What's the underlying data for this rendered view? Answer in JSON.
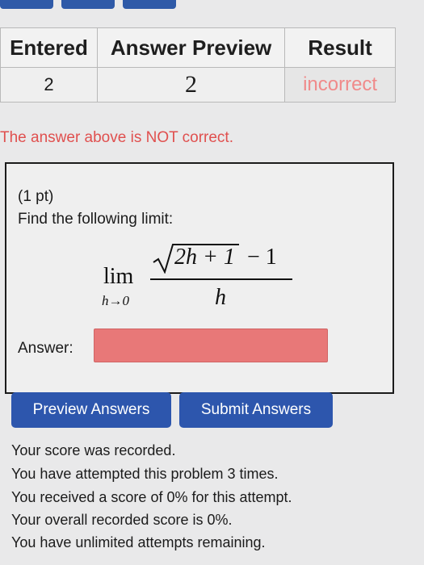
{
  "results_table": {
    "headers": [
      "Entered",
      "Answer Preview",
      "Result"
    ],
    "row": {
      "entered": "2",
      "preview": "2",
      "result": "incorrect"
    }
  },
  "warning": "The answer above is NOT correct.",
  "problem": {
    "points": "(1 pt)",
    "prompt": "Find the following limit:",
    "math": {
      "lim": "lim",
      "subscript": "h→0",
      "numerator_radicand": "2h + 1",
      "numerator_rest": "− 1",
      "denominator": "h"
    },
    "answer_label": "Answer:",
    "answer_value": ""
  },
  "buttons": {
    "preview": "Preview Answers",
    "submit": "Submit Answers"
  },
  "messages": [
    "Your score was recorded.",
    "You have attempted this problem 3 times.",
    "You received a score of 0% for this attempt.",
    "Your overall recorded score is 0%.",
    "You have unlimited attempts remaining."
  ],
  "colors": {
    "button_blue": "#2d56ad",
    "incorrect_red": "#e0504f",
    "answer_field_red": "#e87878"
  }
}
